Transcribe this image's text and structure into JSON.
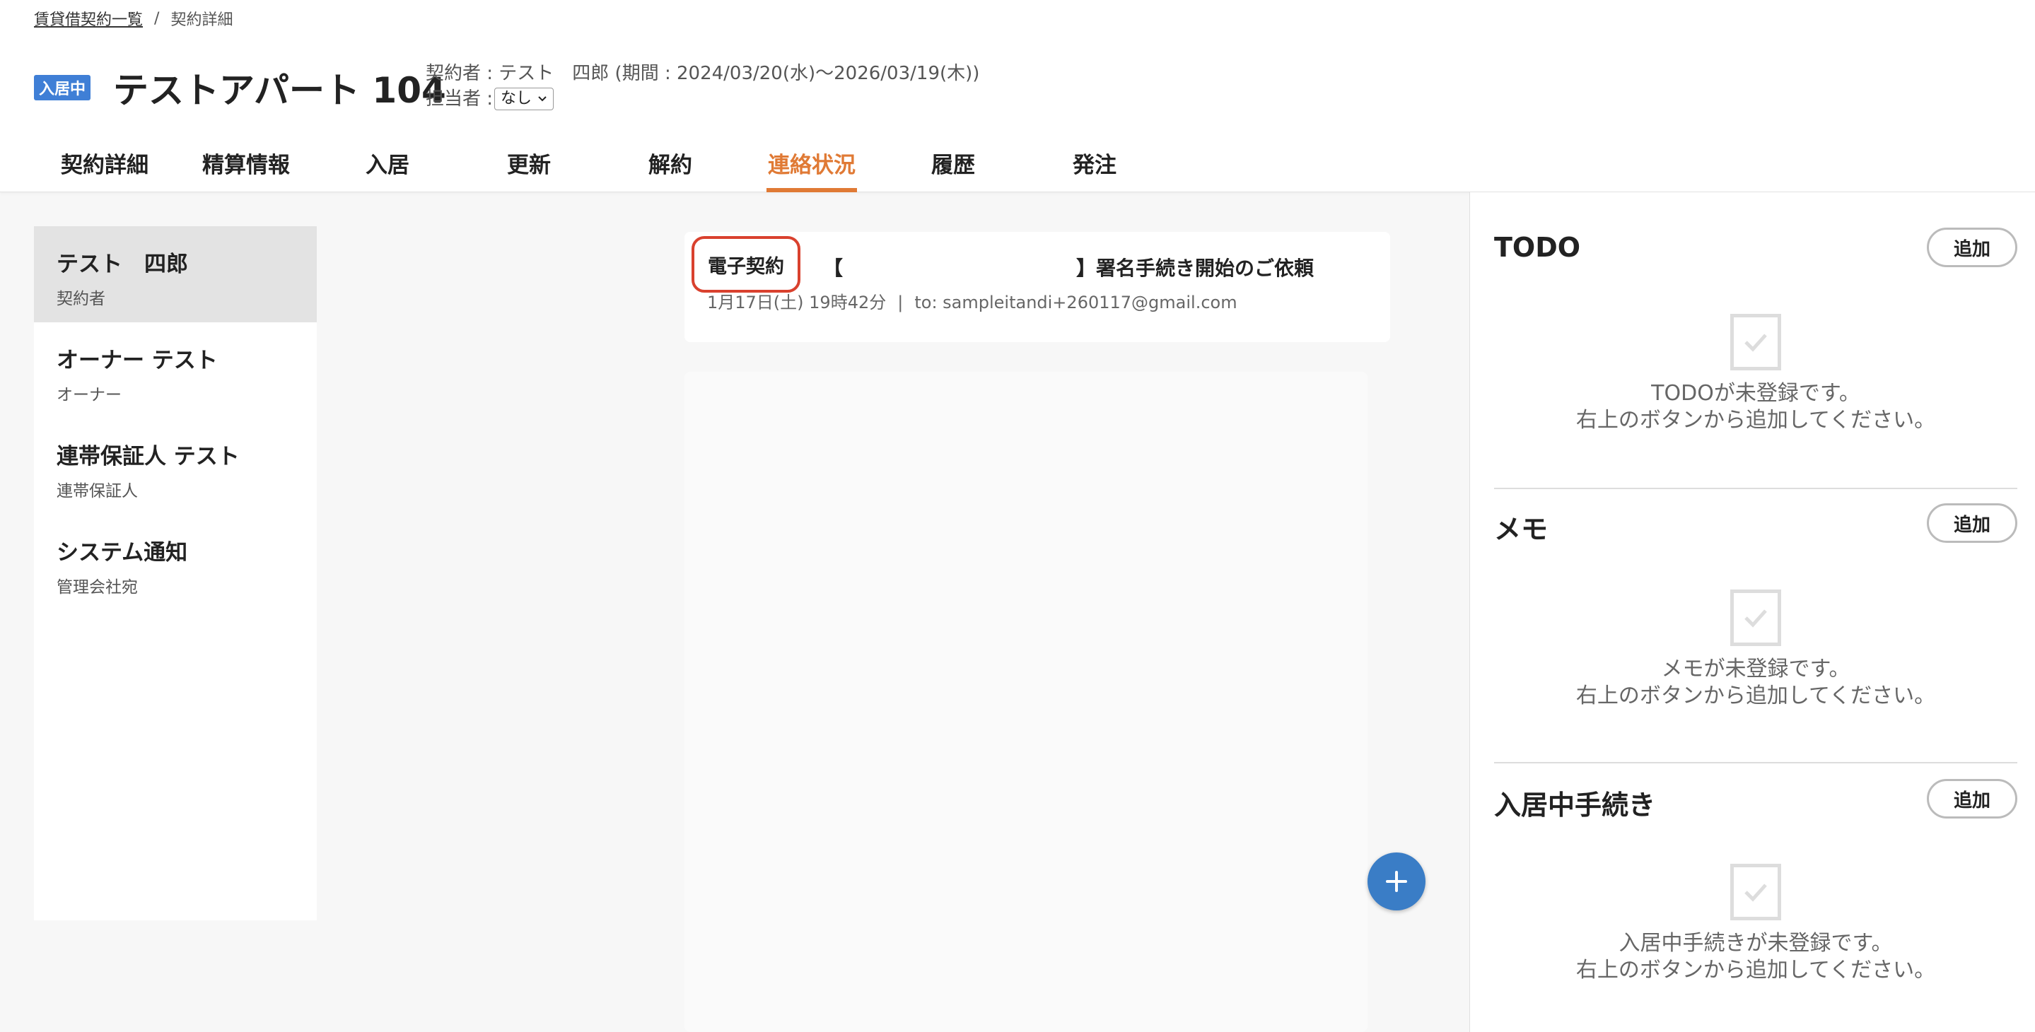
{
  "breadcrumb": {
    "parent": "賃貸借契約一覧",
    "separator": "/",
    "current": "契約詳細"
  },
  "header": {
    "status_badge": "入居中",
    "title": "テストアパート 104",
    "contract_info": "契約者 : テスト　四郎 (期間 : 2024/03/20(水)〜2026/03/19(木))",
    "assignee_label": "担当者 :",
    "assignee_value": "なし"
  },
  "tabs": [
    {
      "label": "契約詳細",
      "active": false
    },
    {
      "label": "精算情報",
      "active": false
    },
    {
      "label": "入居",
      "active": false
    },
    {
      "label": "更新",
      "active": false
    },
    {
      "label": "解約",
      "active": false
    },
    {
      "label": "連絡状況",
      "active": true
    },
    {
      "label": "履歴",
      "active": false
    },
    {
      "label": "発注",
      "active": false
    }
  ],
  "contacts": [
    {
      "name": "テスト　四郎",
      "role": "契約者",
      "selected": true
    },
    {
      "name": "オーナー テスト",
      "role": "オーナー",
      "selected": false
    },
    {
      "name": "連帯保証人 テスト",
      "role": "連帯保証人",
      "selected": false
    },
    {
      "name": "システム通知",
      "role": "管理会社宛",
      "selected": false
    }
  ],
  "message": {
    "tag": "電子契約",
    "subject_open": "【",
    "subject_close": "】署名手続き開始のご依頼",
    "date": "1月17日(土) 19時42分",
    "separator": "|",
    "to": "to: sampleitandi+260117@gmail.com"
  },
  "right_panel": {
    "todo": {
      "title": "TODO",
      "add_label": "追加",
      "empty_line1": "TODOが未登録です。",
      "empty_line2": "右上のボタンから追加してください。"
    },
    "memo": {
      "title": "メモ",
      "add_label": "追加",
      "empty_line1": "メモが未登録です。",
      "empty_line2": "右上のボタンから追加してください。"
    },
    "movein": {
      "title": "入居中手続き",
      "add_label": "追加",
      "empty_line1": "入居中手続きが未登録です。",
      "empty_line2": "右上のボタンから追加してください。"
    }
  },
  "colors": {
    "accent_orange": "#e07a35",
    "badge_blue": "#3f7fd6",
    "fab_blue": "#3a7dc6",
    "highlight_red": "#d9412e"
  },
  "icons": {
    "fab": "plus-icon",
    "empty_state": "checkbox-icon",
    "select": "chevron-down-icon"
  }
}
